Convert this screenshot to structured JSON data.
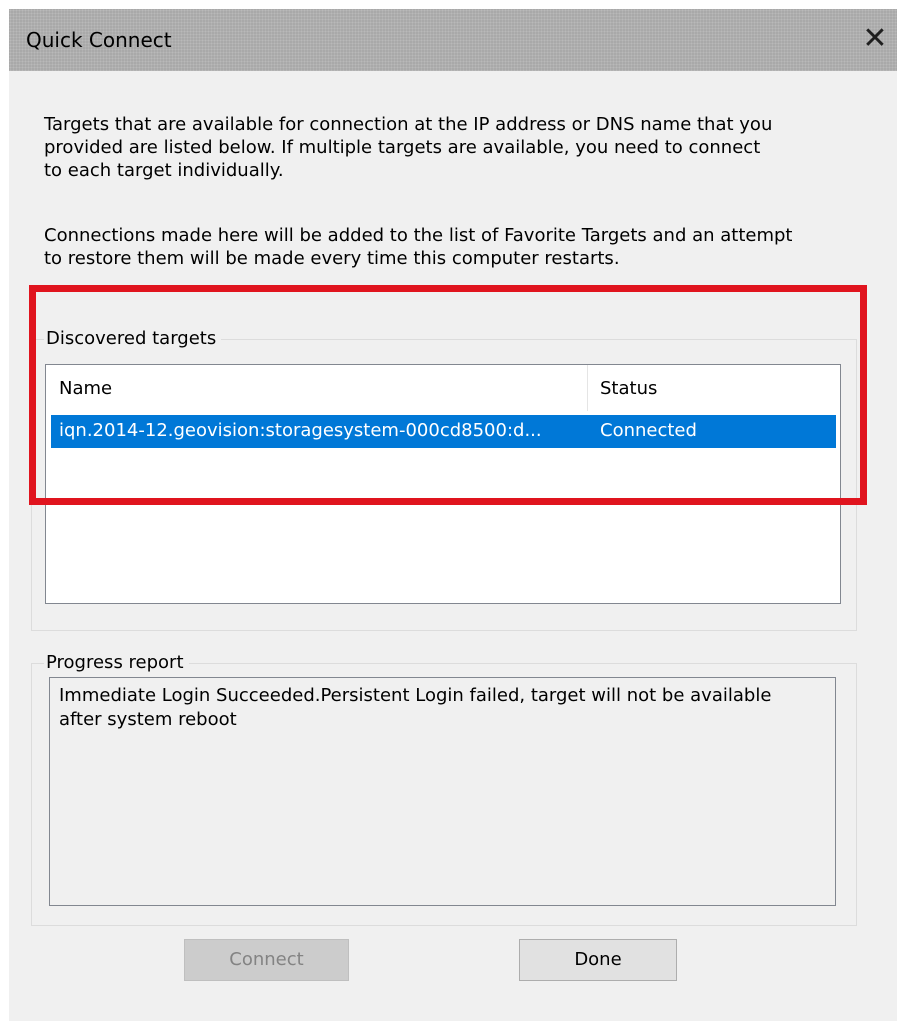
{
  "window": {
    "title": "Quick Connect",
    "close_glyph": "✕"
  },
  "intro": {
    "paragraph1": "Targets that are available for connection at the IP address or DNS name that you\nprovided are listed below.  If multiple targets are available, you need to connect\nto each target individually.",
    "paragraph2": "Connections made here will be added to the list of Favorite Targets and an attempt\nto restore them will be made every time this computer restarts."
  },
  "discovered": {
    "label": "Discovered targets",
    "columns": [
      "Name",
      "Status"
    ],
    "rows": [
      {
        "name": "iqn.2014-12.geovision:storagesystem-000cd8500:d...",
        "status": "Connected",
        "selected": true
      }
    ]
  },
  "progress": {
    "label": "Progress report",
    "text": "Immediate Login Succeeded.Persistent Login failed, target will not be available\nafter system reboot"
  },
  "buttons": {
    "connect": "Connect",
    "done": "Done"
  },
  "annotation": {
    "highlight_color": "#e0141e"
  },
  "colors": {
    "selection": "#0078d7",
    "titlebar": "#a9a9a9"
  }
}
